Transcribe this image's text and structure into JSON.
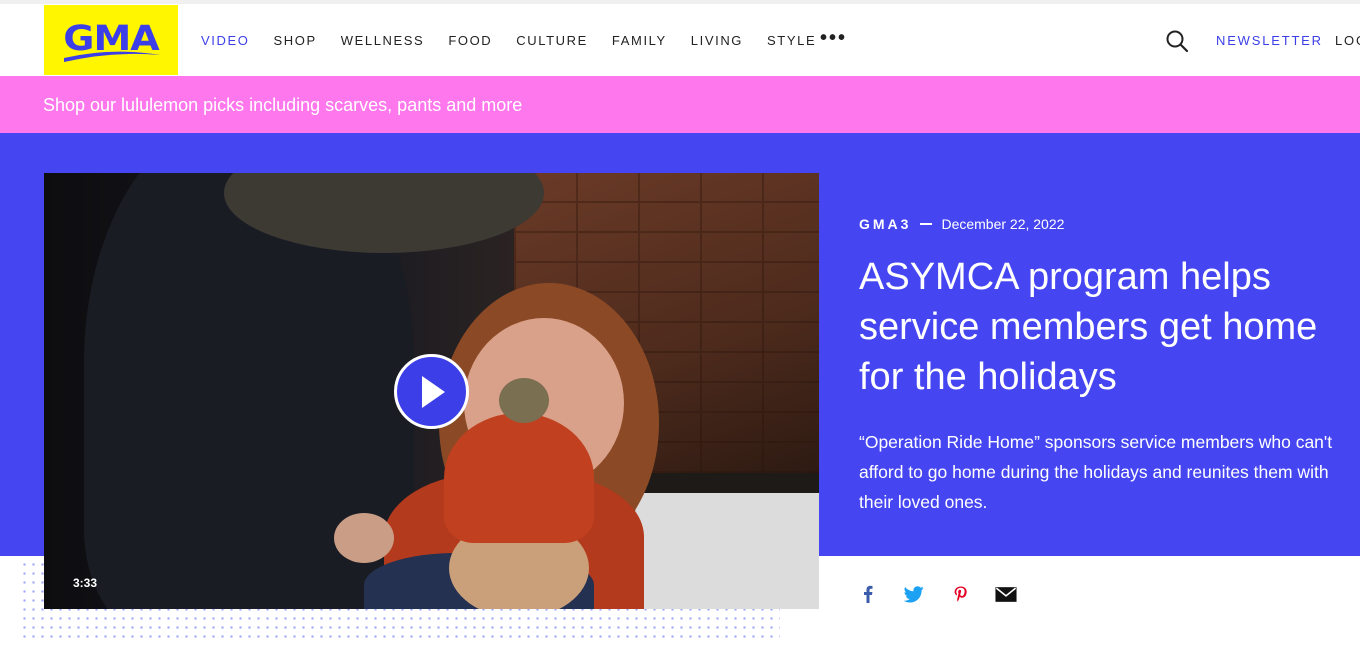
{
  "header": {
    "logo_text": "GMA",
    "nav": [
      "VIDEO",
      "SHOP",
      "WELLNESS",
      "FOOD",
      "CULTURE",
      "FAMILY",
      "LIVING",
      "STYLE"
    ],
    "more": "•••",
    "newsletter": "NEWSLETTER",
    "login": "LOG"
  },
  "promo": {
    "text": "Shop our lululemon picks including scarves, pants and more"
  },
  "article": {
    "show": "GMA3",
    "date": "December 22, 2022",
    "title": "ASYMCA program helps service members get home for the holidays",
    "description": "“Operation Ride Home” sponsors service members who can't afford to go home during the holidays and reunites them with their loved ones.",
    "video_duration": "3:33"
  },
  "colors": {
    "brand_blue": "#3c3fe8",
    "hero_bg": "#4545f2",
    "promo_bg": "#ff77ec",
    "logo_bg": "#fff600"
  },
  "icons": [
    "search-icon",
    "play-icon",
    "facebook-icon",
    "twitter-icon",
    "pinterest-icon",
    "email-icon"
  ]
}
